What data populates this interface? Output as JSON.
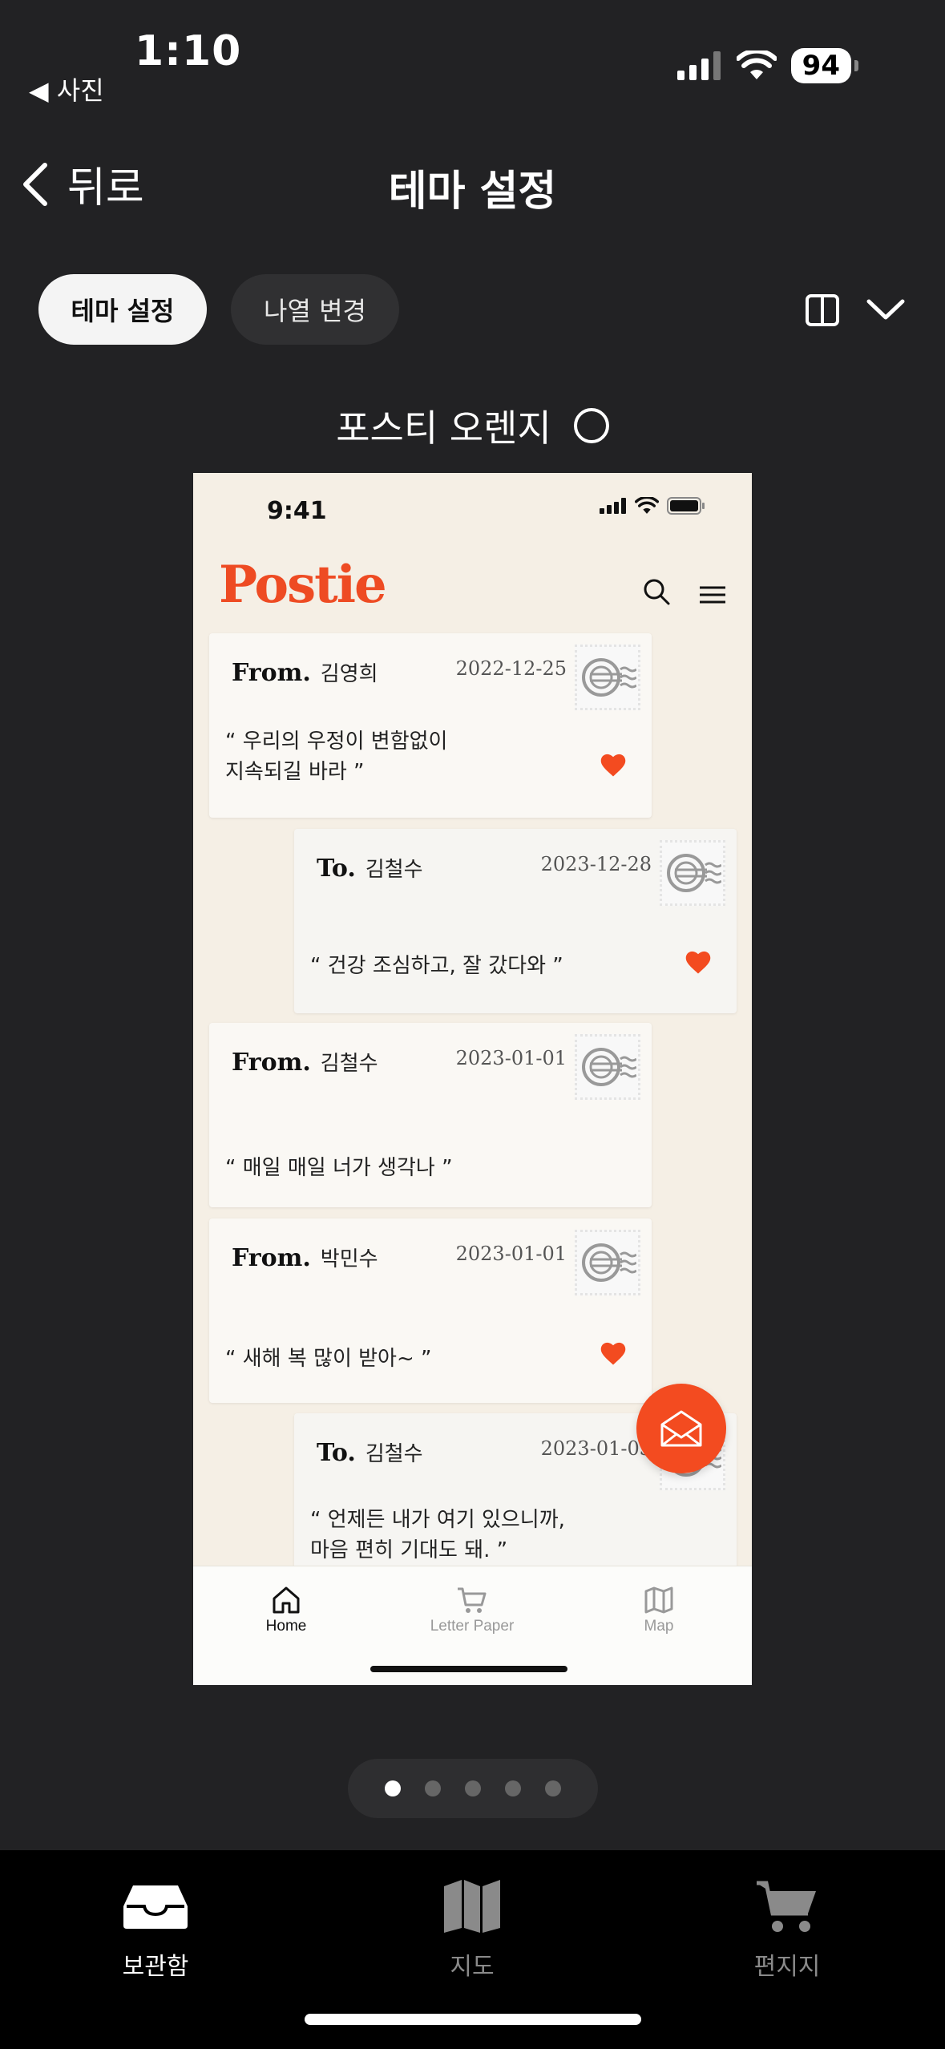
{
  "status_bar": {
    "time": "1:10",
    "back_app": "◀ 사진",
    "battery": "94"
  },
  "nav": {
    "back_label": "뒤로",
    "title": "테마 설정"
  },
  "chips": [
    {
      "label": "테마 설정"
    },
    {
      "label": "나열 변경"
    }
  ],
  "theme": {
    "name": "포스티 오렌지"
  },
  "preview": {
    "status_time": "9:41",
    "logo": "Postie",
    "cards": [
      {
        "kind": "From.",
        "name": "김영희",
        "date": "2022-12-25",
        "message": "“ 우리의 우정이 변함없이\n지속되길 바라 ”",
        "liked": true
      },
      {
        "kind": "To.",
        "name": "김철수",
        "date": "2023-12-28",
        "message": "“ 건강 조심하고, 잘 갔다와 ”",
        "liked": true
      },
      {
        "kind": "From.",
        "name": "김철수",
        "date": "2023-01-01",
        "message": "“ 매일 매일 너가 생각나 ”",
        "liked": false
      },
      {
        "kind": "From.",
        "name": "박민수",
        "date": "2023-01-01",
        "message": "“ 새해 복 많이 받아~ ”",
        "liked": true
      },
      {
        "kind": "To.",
        "name": "김철수",
        "date": "2023-01-03",
        "message": "“ 언제든 내가 여기 있으니까,\n마음 편히 기대도 돼. ”",
        "liked": false
      }
    ],
    "tabs": [
      {
        "label": "Home"
      },
      {
        "label": "Letter Paper"
      },
      {
        "label": "Map"
      }
    ],
    "accent_color": "#ee4b23"
  },
  "pager": {
    "count": 5,
    "active_index": 0
  },
  "tabbar": {
    "items": [
      {
        "label": "보관함"
      },
      {
        "label": "지도"
      },
      {
        "label": "편지지"
      }
    ]
  }
}
